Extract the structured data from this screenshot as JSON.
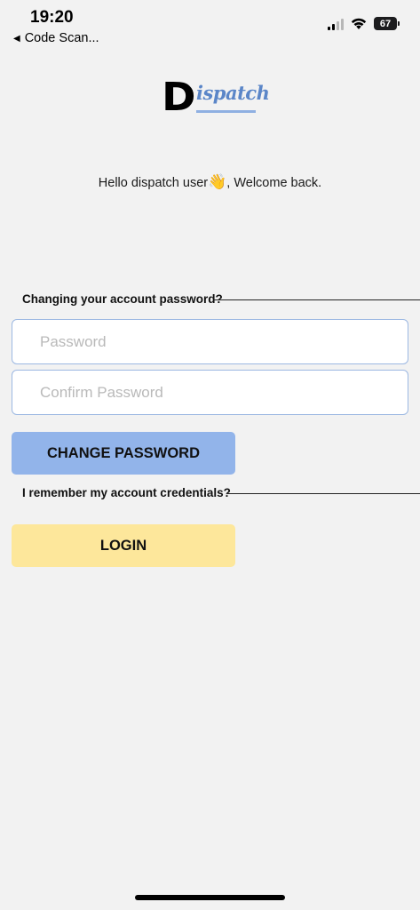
{
  "status_bar": {
    "time": "19:20",
    "back_app": "Code Scan...",
    "back_icon": "left-triangle",
    "battery": "67"
  },
  "logo": {
    "letter": "D",
    "word": "ispatch"
  },
  "welcome": {
    "before": "Hello dispatch user",
    "emoji": "👋",
    "after": ", Welcome back."
  },
  "change_section": {
    "label": "Changing your account password?",
    "password_placeholder": "Password",
    "confirm_placeholder": "Confirm Password",
    "button": "CHANGE PASSWORD"
  },
  "login_section": {
    "label": "I remember my account credentials?",
    "button": "LOGIN"
  },
  "colors": {
    "background": "#f2f2f2",
    "change_button": "#92b4ea",
    "login_button": "#fde79b",
    "field_border": "#9cb8e2",
    "logo_blue": "#5b86c8"
  }
}
